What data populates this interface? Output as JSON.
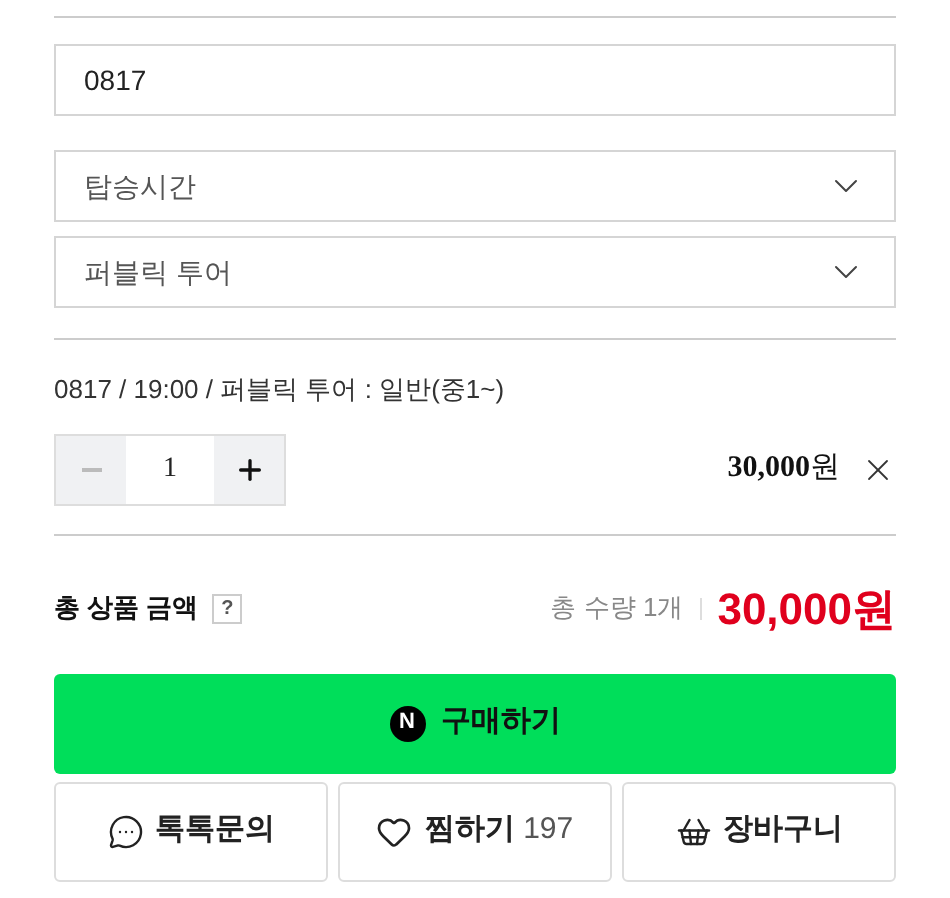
{
  "date_field": {
    "value": "0817"
  },
  "selects": [
    {
      "placeholder": "탑승시간"
    },
    {
      "placeholder": "퍼블릭 투어"
    }
  ],
  "option": {
    "label": "0817 / 19:00 / 퍼블릭 투어 : 일반(중1~)",
    "quantity": "1",
    "price": "30,000",
    "currency": "원"
  },
  "total": {
    "label": "총 상품 금액",
    "help": "?",
    "count": "총 수량 1개",
    "price": "30,000",
    "currency": "원"
  },
  "buy_button": {
    "logo": "N",
    "label": "구매하기"
  },
  "actions": [
    {
      "kind": "talk",
      "label": "톡톡문의"
    },
    {
      "kind": "wish",
      "label": "찜하기",
      "count": "197"
    },
    {
      "kind": "cart",
      "label": "장바구니"
    }
  ]
}
